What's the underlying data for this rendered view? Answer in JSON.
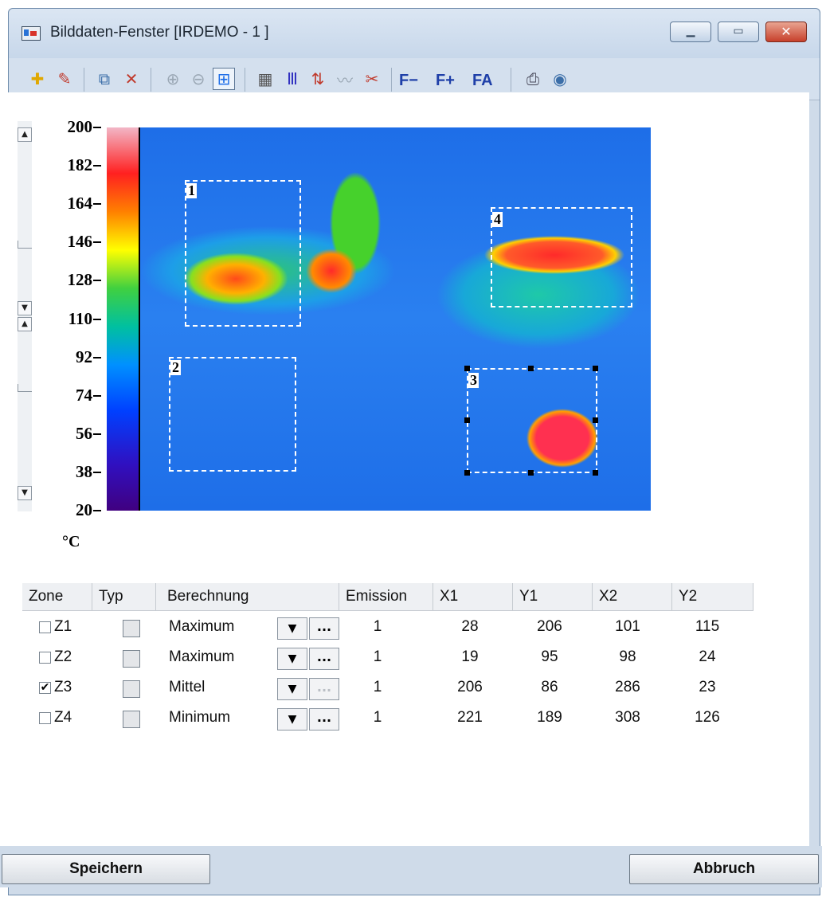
{
  "window": {
    "title": "Bilddaten-Fenster [IRDEMO - 1 ]"
  },
  "window_controls": {
    "minimize_glyph": "▁",
    "maximize_glyph": "▭",
    "close_glyph": "✕"
  },
  "toolbar": {
    "icons": [
      "zone-add-icon",
      "zone-edit-icon",
      "copy-icon",
      "delete-icon",
      "zoom-in-icon",
      "zoom-out-icon",
      "fit-icon",
      "zone-grid-icon",
      "palette-icon",
      "sort-icon",
      "profile-icon",
      "tools-icon",
      "print-icon",
      "help-icon"
    ],
    "font_minus": "F−",
    "font_plus": "F+",
    "font_auto": "FA"
  },
  "scale": {
    "labels": [
      "200",
      "182",
      "164",
      "146",
      "128",
      "110",
      "92",
      "74",
      "56",
      "38",
      "20"
    ],
    "unit": "°C",
    "min": 20,
    "max": 200
  },
  "zones_overlay": [
    {
      "label": "1"
    },
    {
      "label": "2"
    },
    {
      "label": "3",
      "selected": true
    },
    {
      "label": "4"
    }
  ],
  "table": {
    "headers": [
      "Zone",
      "Typ",
      "Berechnung",
      "Emission",
      "X1",
      "Y1",
      "X2",
      "Y2"
    ],
    "rows": [
      {
        "checked": false,
        "zone": "Z1",
        "berechnung": "Maximum",
        "emission": "1",
        "x1": "28",
        "y1": "206",
        "x2": "101",
        "y2": "115",
        "dots_enabled": true
      },
      {
        "checked": false,
        "zone": "Z2",
        "berechnung": "Maximum",
        "emission": "1",
        "x1": "19",
        "y1": "95",
        "x2": "98",
        "y2": "24",
        "dots_enabled": true
      },
      {
        "checked": true,
        "zone": "Z3",
        "berechnung": "Mittel",
        "emission": "1",
        "x1": "206",
        "y1": "86",
        "x2": "286",
        "y2": "23",
        "dots_enabled": false
      },
      {
        "checked": false,
        "zone": "Z4",
        "berechnung": "Minimum",
        "emission": "1",
        "x1": "221",
        "y1": "189",
        "x2": "308",
        "y2": "126",
        "dots_enabled": true
      }
    ],
    "dots_label": "...",
    "dropdown_glyph": "▼",
    "check_glyph": "✔"
  },
  "buttons": {
    "save": "Speichern",
    "cancel": "Abbruch"
  }
}
